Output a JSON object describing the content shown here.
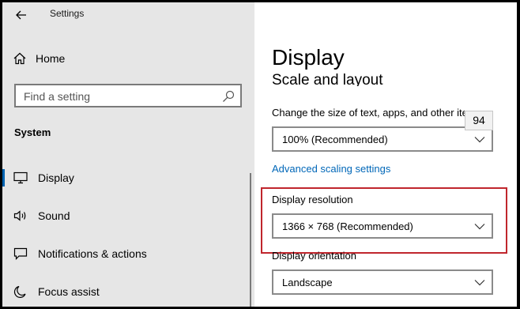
{
  "window": {
    "title": "Settings"
  },
  "sidebar": {
    "home_label": "Home",
    "search_placeholder": "Find a setting",
    "section": "System",
    "items": [
      {
        "label": "Display",
        "icon": "monitor-icon",
        "active": true
      },
      {
        "label": "Sound",
        "icon": "speaker-icon",
        "active": false
      },
      {
        "label": "Notifications & actions",
        "icon": "notification-icon",
        "active": false
      },
      {
        "label": "Focus assist",
        "icon": "moon-icon",
        "active": false
      }
    ]
  },
  "main": {
    "page_title": "Display",
    "section_title": "Scale and layout",
    "scale": {
      "label": "Change the size of text, apps, and other items",
      "value": "100% (Recommended)",
      "tooltip": "94"
    },
    "advanced_link": "Advanced scaling settings",
    "resolution": {
      "label": "Display resolution",
      "value": "1366 × 768 (Recommended)"
    },
    "orientation": {
      "label": "Display orientation",
      "value": "Landscape"
    }
  },
  "colors": {
    "accent": "#0063b1",
    "link": "#0067b8",
    "highlight": "#c0262d",
    "sidebar_bg": "#e6e6e6"
  }
}
